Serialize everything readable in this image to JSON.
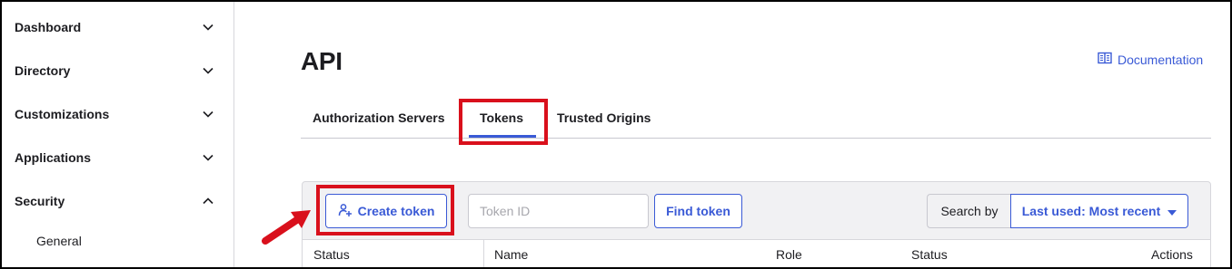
{
  "sidebar": {
    "items": [
      {
        "label": "Dashboard",
        "expanded": false
      },
      {
        "label": "Directory",
        "expanded": false
      },
      {
        "label": "Customizations",
        "expanded": false
      },
      {
        "label": "Applications",
        "expanded": false
      },
      {
        "label": "Security",
        "expanded": true
      }
    ],
    "sub_items": [
      {
        "label": "General"
      }
    ]
  },
  "header": {
    "title": "API",
    "doc_link": "Documentation",
    "doc_icon": "book-icon"
  },
  "tabs": [
    {
      "label": "Authorization Servers",
      "active": false
    },
    {
      "label": "Tokens",
      "active": true
    },
    {
      "label": "Trusted Origins",
      "active": false
    }
  ],
  "toolbar": {
    "create_label": "Create token",
    "create_icon": "add-user-icon",
    "search_placeholder": "Token ID",
    "find_label": "Find token",
    "search_by_label": "Search by",
    "sort_selected": "Last used: Most recent"
  },
  "table": {
    "columns": [
      "Status",
      "Name",
      "Role",
      "Status",
      "Actions"
    ]
  },
  "colors": {
    "accent": "#3a5ad6",
    "highlight": "#d9101c"
  }
}
